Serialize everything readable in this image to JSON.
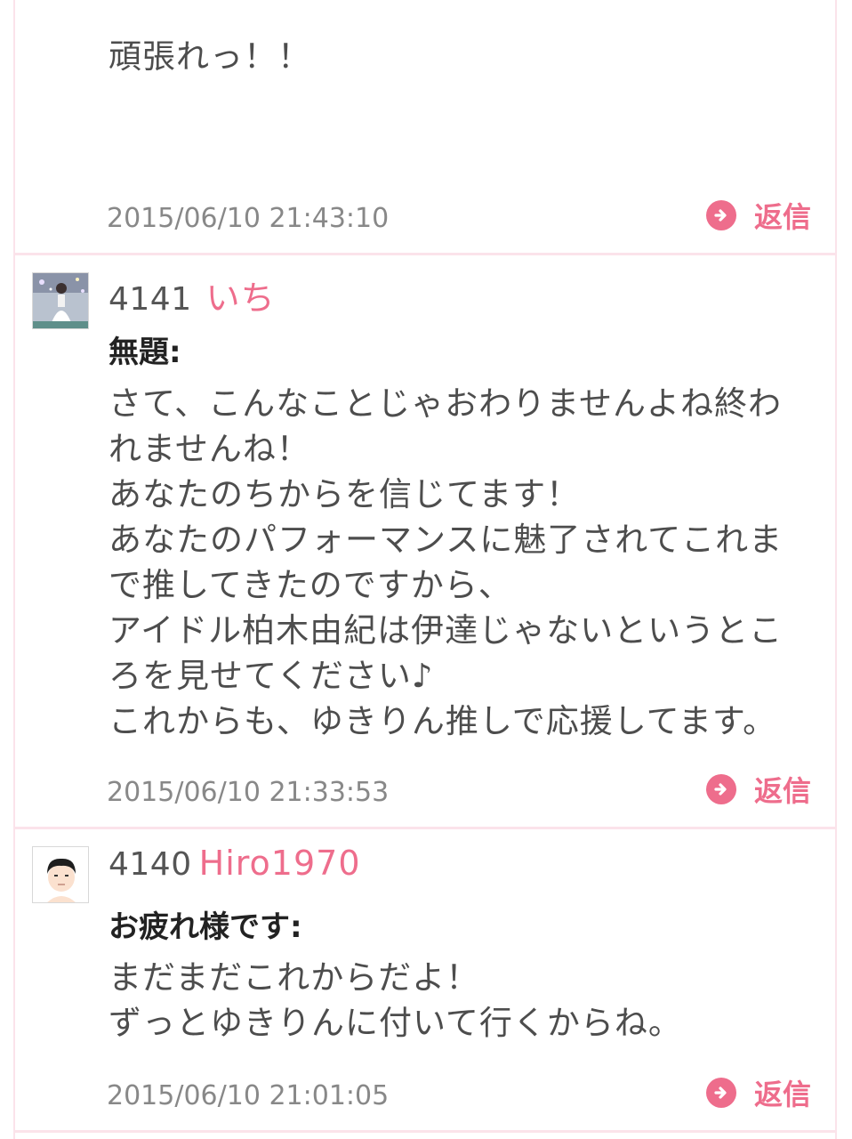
{
  "posts": [
    {
      "body": [
        "頑張れっ！！"
      ],
      "timestamp": "2015/06/10 21:43:10",
      "reply_label": "返信"
    },
    {
      "number": "4141",
      "username": "いち",
      "subject": "無題:",
      "body": [
        "さて、こんなことじゃおわりませんよね終わ",
        "れませんね！",
        "あなたのちからを信じてます！",
        "あなたのパフォーマンスに魅了されてこれま",
        "で推してきたのですから、",
        "アイドル柏木由紀は伊達じゃないというとこ",
        "ろを見せてください♪",
        "これからも、ゆきりん推しで応援してます。"
      ],
      "timestamp": "2015/06/10 21:33:53",
      "reply_label": "返信"
    },
    {
      "number": "4140",
      "username": "Hiro1970",
      "subject": "お疲れ様です:",
      "body": [
        "まだまだこれからだよ！",
        "ずっとゆきりんに付いて行くからね。"
      ],
      "timestamp": "2015/06/10 21:01:05",
      "reply_label": "返信"
    }
  ],
  "colors": {
    "accent": "#ee6d8c",
    "border": "#fbe3ea",
    "text": "#4d4d4d",
    "timestamp": "#888888"
  }
}
